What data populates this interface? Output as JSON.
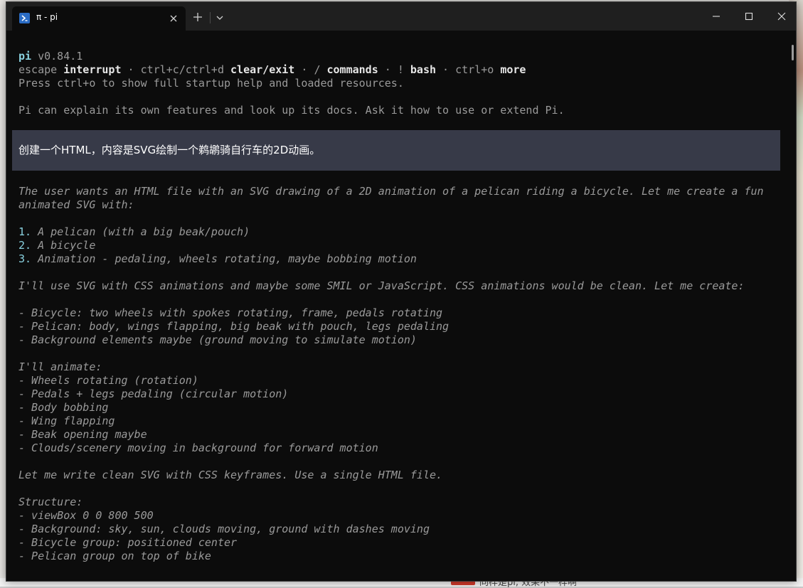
{
  "window": {
    "tab_title": "π - pi",
    "tab_icon": "powershell-icon",
    "controls": [
      "minimize-icon",
      "maximize-icon",
      "close-icon"
    ]
  },
  "desktop": {
    "bottom_text": "同样是pi, 效果不一样啊"
  },
  "colors": {
    "terminal_bg": "#0c0c0c",
    "titlebar_bg": "#1f1f1f",
    "user_block_bg": "#373a48",
    "accent": "#8ad2e0",
    "dim_text": "#9a9a9a",
    "bright_text": "#e6e6e6"
  },
  "header": {
    "app_name": "pi",
    "version": "v0.84.1",
    "help": {
      "k1": "escape",
      "a1": "interrupt",
      "k2": "ctrl+c/ctrl+d",
      "a2": "clear/exit",
      "k3": "/",
      "a3": "commands",
      "k4": "!",
      "a4": "bash",
      "k5": "ctrl+o",
      "a5": "more",
      "sep": " · "
    },
    "startup_hint": "Press ctrl+o to show full startup help and loaded resources.",
    "intro": "Pi can explain its own features and look up its docs. Ask it how to use or extend Pi."
  },
  "user_message": "创建一个HTML，内容是SVG绘制一个鹈鹕骑自行车的2D动画。",
  "thinking": {
    "l1": "The user wants an HTML file with an SVG drawing of a 2D animation of a pelican riding a bicycle. Let me create a fun",
    "l2": "animated SVG with:",
    "list": [
      {
        "num": "1.",
        "text": " A pelican (with a big beak/pouch)"
      },
      {
        "num": "2.",
        "text": " A bicycle"
      },
      {
        "num": "3.",
        "text": " Animation - pedaling, wheels rotating, maybe bobbing motion"
      }
    ],
    "l3": "I'll use SVG with CSS animations and maybe some SMIL or JavaScript. CSS animations would be clean. Let me create:",
    "bullets1": [
      "- Bicycle: two wheels with spokes rotating, frame, pedals rotating",
      "- Pelican: body, wings flapping, big beak with pouch, legs pedaling",
      "- Background elements maybe (ground moving to simulate motion)"
    ],
    "l4": "I'll animate:",
    "bullets2": [
      "- Wheels rotating (rotation)",
      "- Pedals + legs pedaling (circular motion)",
      "- Body bobbing",
      "- Wing flapping",
      "- Beak opening maybe",
      "- Clouds/scenery moving in background for forward motion"
    ],
    "l5": "Let me write clean SVG with CSS keyframes. Use a single HTML file.",
    "l6": "Structure:",
    "bullets3": [
      "- viewBox 0 0 800 500",
      "- Background: sky, sun, clouds moving, ground with dashes moving",
      "- Bicycle group: positioned center",
      "- Pelican group on top of bike"
    ]
  }
}
